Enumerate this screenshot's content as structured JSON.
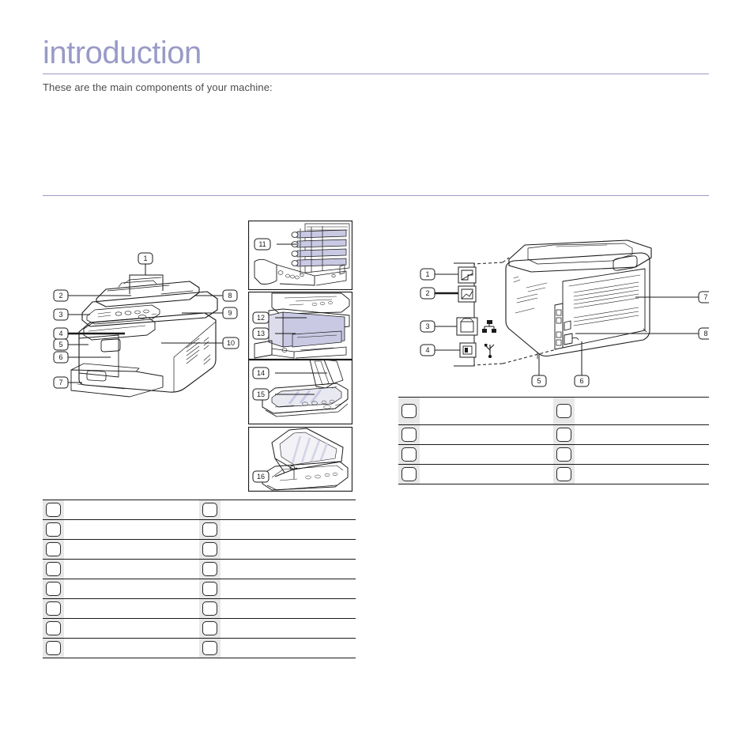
{
  "header": {
    "title": "introduction",
    "subtitle": "These are the main components of your machine:",
    "accent_color": "#9a9ac8",
    "text_color": "#4d4d4d"
  },
  "figures": {
    "front_view": {
      "name": "front-view",
      "callouts": [
        "1",
        "2",
        "3",
        "4",
        "5",
        "6",
        "7",
        "8",
        "9",
        "10"
      ]
    },
    "detail_panels": [
      {
        "name": "toner-cartridge-detail",
        "callouts": [
          "11"
        ]
      },
      {
        "name": "front-cover-detail",
        "callouts": [
          "12",
          "13"
        ]
      },
      {
        "name": "scanner-lid-detail",
        "callouts": [
          "14",
          "15"
        ]
      },
      {
        "name": "adf-tray-detail",
        "callouts": [
          "16"
        ]
      }
    ],
    "rear_view": {
      "name": "rear-view",
      "callouts": [
        "1",
        "2",
        "3",
        "4",
        "5",
        "6",
        "7",
        "8"
      ],
      "port_icons": [
        "network-port-icon",
        "usb-port-icon"
      ]
    }
  },
  "legend_front": {
    "name": "front-view-legend",
    "rows": [
      {
        "left_num": "",
        "left_label": "",
        "right_num": "",
        "right_label": ""
      },
      {
        "left_num": "",
        "left_label": "",
        "right_num": "",
        "right_label": ""
      },
      {
        "left_num": "",
        "left_label": "",
        "right_num": "",
        "right_label": ""
      },
      {
        "left_num": "",
        "left_label": "",
        "right_num": "",
        "right_label": ""
      },
      {
        "left_num": "",
        "left_label": "",
        "right_num": "",
        "right_label": ""
      },
      {
        "left_num": "",
        "left_label": "",
        "right_num": "",
        "right_label": ""
      },
      {
        "left_num": "",
        "left_label": "",
        "right_num": "",
        "right_label": ""
      },
      {
        "left_num": "",
        "left_label": "",
        "right_num": "",
        "right_label": ""
      }
    ]
  },
  "legend_rear": {
    "name": "rear-view-legend",
    "rows": [
      {
        "left_num": "",
        "left_label": "",
        "right_num": "",
        "right_label": ""
      },
      {
        "left_num": "",
        "left_label": "",
        "right_num": "",
        "right_label": ""
      },
      {
        "left_num": "",
        "left_label": "",
        "right_num": "",
        "right_label": ""
      },
      {
        "left_num": "",
        "left_label": "",
        "right_num": "",
        "right_label": ""
      }
    ]
  },
  "colors": {
    "accent": "#9a9ac8",
    "line": "#1a1a1a",
    "shade": "#e8e8e8",
    "highlight": "#c9c9e4"
  }
}
